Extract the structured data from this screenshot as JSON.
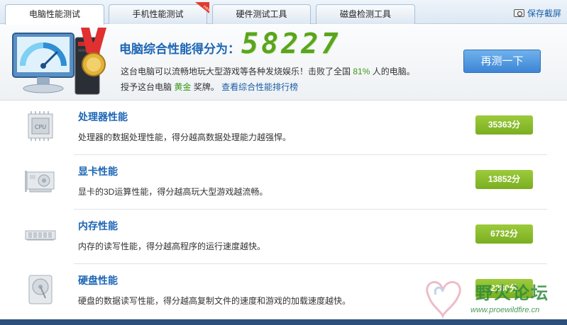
{
  "tabs": [
    {
      "label": "电脑性能测试",
      "active": true
    },
    {
      "label": "手机性能测试",
      "active": false,
      "badge": "new"
    },
    {
      "label": "硬件测试工具",
      "active": false
    },
    {
      "label": "磁盘检测工具",
      "active": false
    }
  ],
  "save_screenshot": "保存截屏",
  "summary": {
    "score_label": "电脑综合性能得分为：",
    "score": "58227",
    "line1_prefix": "这台电脑可以流畅地玩大型游戏等各种发烧娱乐！击败了全国",
    "beat_percent": "81%",
    "line1_suffix": "人的电脑。",
    "line2_prefix": "授予这台电脑",
    "medal": "黄金",
    "line2_mid": "奖牌。",
    "rank_link": "查看综合性能排行榜",
    "retest_button": "再测一下"
  },
  "rows": [
    {
      "title": "处理器性能",
      "desc": "处理器的数据处理性能，得分越高数据处理能力越强悍。",
      "score": "35363分",
      "icon": "cpu-icon"
    },
    {
      "title": "显卡性能",
      "desc": "显卡的3D运算性能，得分越高玩大型游戏越流畅。",
      "score": "13852分",
      "icon": "graphics-card-icon"
    },
    {
      "title": "内存性能",
      "desc": "内存的读写性能，得分越高程序的运行速度越快。",
      "score": "6732分",
      "icon": "memory-icon"
    },
    {
      "title": "硬盘性能",
      "desc": "硬盘的数据读写性能，得分越高复制文件的速度和游戏的加载速度越快。",
      "score": "2280分",
      "icon": "hard-disk-icon"
    }
  ],
  "watermark": {
    "name": "野火论坛",
    "url": "www.proewildfire.cn"
  },
  "colors": {
    "accent": "#1d66b5",
    "score_green": "#5aa51d",
    "badge_green": "#8abd2e"
  }
}
